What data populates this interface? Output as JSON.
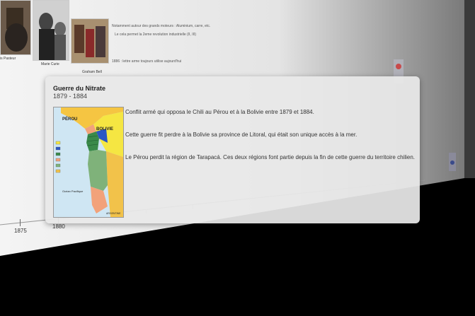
{
  "wall": {
    "people": [
      "is Pasteur",
      "Marie Curie",
      "Graham Bell"
    ],
    "notes": [
      "Notamment autour des grands moteurs : Aluminium, carre, etc.",
      "Le cela permet la 2eme revolution industrielle (II, III)",
      "1886 : lettre arme toujours utilise aujourd'hui"
    ],
    "years": [
      "1875",
      "1880"
    ]
  },
  "popup": {
    "title": "Guerre du Nitrate",
    "dates": "1879 - 1884",
    "paragraphs": [
      "Conflit armé qui opposa le Chili au Pérou et à la Bolivie entre 1879 et 1884.",
      "Cette guerre fit perdre à la Bolivie sa province de Litoral, qui était son unique accès à la mer.",
      "Le Pérou perdit la région de Tarapacá. Ces deux régions font partie depuis la fin de cette guerre du territoire chilien."
    ],
    "map": {
      "labels": [
        "PÉROU",
        "BOLIVIE",
        "Océan Pacifique",
        "ARGENTINE"
      ]
    }
  },
  "colors": {
    "popup_bg": "#e8e8e8",
    "peru": "#f5c542",
    "bolivia": "#f5e642",
    "litoral": "#2b56c4",
    "tarapaca": "#3a8a4a",
    "chile": "#f2a27a",
    "argentina": "#f2c24a"
  }
}
